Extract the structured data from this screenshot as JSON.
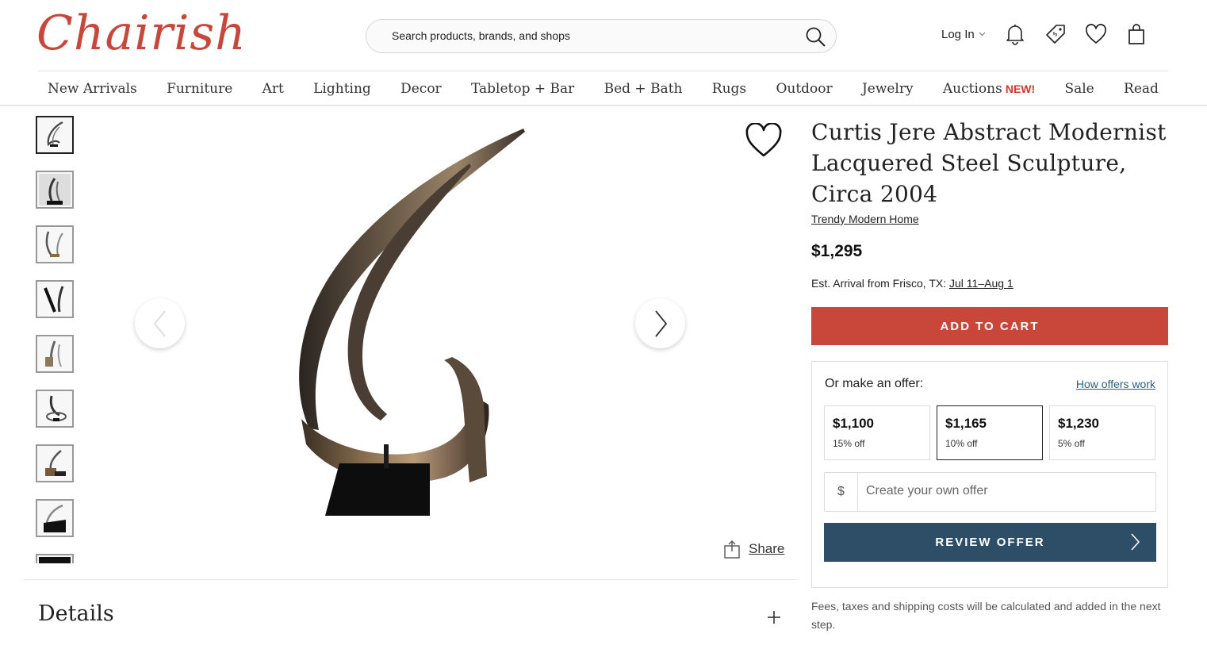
{
  "header": {
    "logo": "Chairish",
    "search_placeholder": "Search products, brands, and shops",
    "login_label": "Log In"
  },
  "nav": {
    "items": [
      "New Arrivals",
      "Furniture",
      "Art",
      "Lighting",
      "Decor",
      "Tabletop + Bar",
      "Bed + Bath",
      "Rugs",
      "Outdoor",
      "Jewelry",
      "Auctions",
      "Sale",
      "Read"
    ],
    "auctions_badge": "NEW!"
  },
  "gallery": {
    "share_label": "Share",
    "thumb_count": 9
  },
  "product": {
    "title": "Curtis Jere Abstract Modernist Lacquered Steel Sculpture, Circa 2004",
    "seller": "Trendy Modern Home",
    "price": "$1,295",
    "arrival_prefix": "Est. Arrival from Frisco, TX:",
    "arrival_dates": "Jul 11–Aug 1",
    "add_to_cart": "ADD TO CART"
  },
  "offer": {
    "label": "Or make an offer:",
    "how_link": "How offers work",
    "options": [
      {
        "amount": "$1,100",
        "discount": "15% off"
      },
      {
        "amount": "$1,165",
        "discount": "10% off",
        "selected": true
      },
      {
        "amount": "$1,230",
        "discount": "5% off"
      }
    ],
    "currency_symbol": "$",
    "custom_placeholder": "Create your own offer",
    "review_label": "REVIEW OFFER",
    "fees_note": "Fees, taxes and shipping costs will be calculated and added in the next step."
  },
  "details": {
    "heading": "Details"
  },
  "colors": {
    "brand_red": "#c9463a",
    "review_blue": "#2e4e68",
    "link_blue": "#2e5f7e"
  }
}
